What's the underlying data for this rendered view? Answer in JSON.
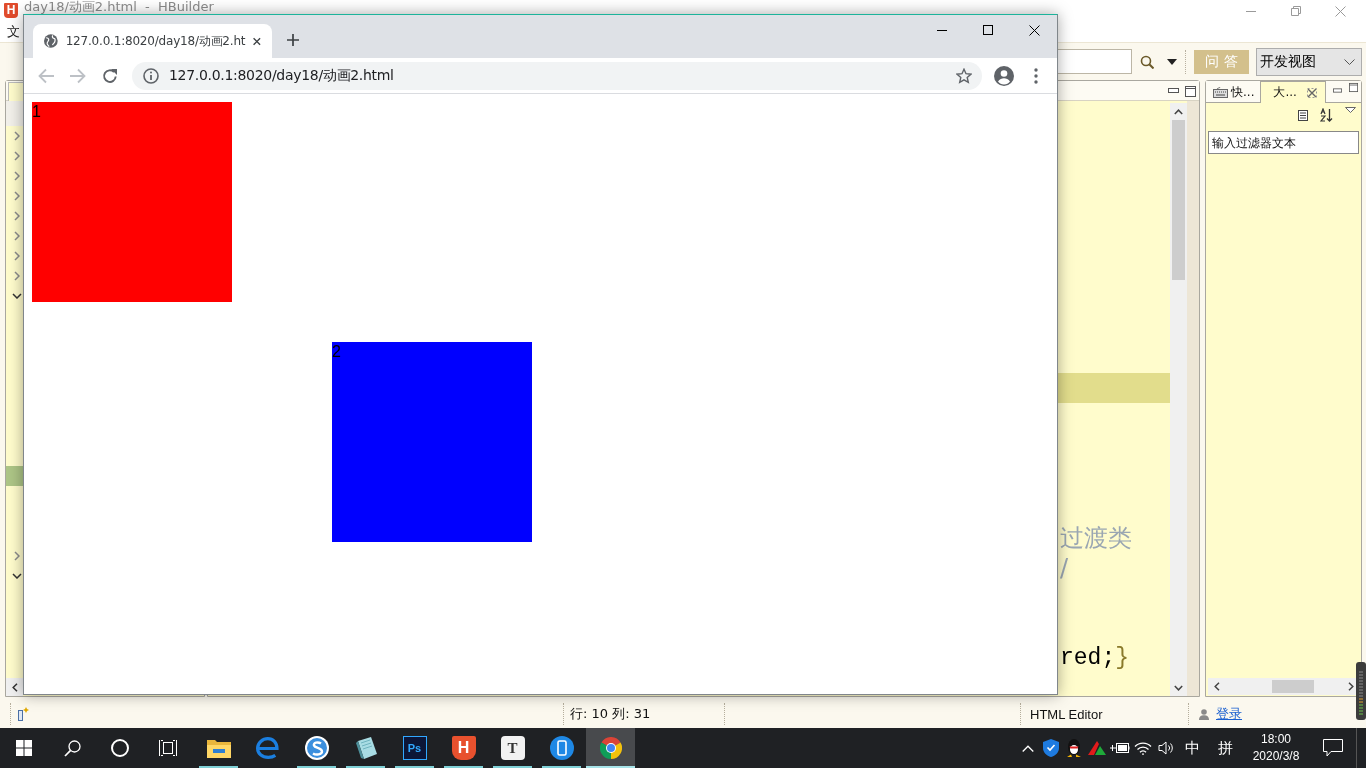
{
  "hbuilder": {
    "logo": "H",
    "title": "day18/动画2.html  -  HBuilder",
    "menu": [
      "文"
    ],
    "toolbar": {
      "qa_button": "问 答",
      "view_select": "开发视图"
    },
    "project_tree": [
      {
        "kind": "branch",
        "expanded": false,
        "selected": false
      },
      {
        "kind": "branch",
        "expanded": false,
        "selected": false
      },
      {
        "kind": "branch",
        "expanded": false,
        "selected": false
      },
      {
        "kind": "branch",
        "expanded": false,
        "selected": false
      },
      {
        "kind": "branch",
        "expanded": false,
        "selected": false
      },
      {
        "kind": "branch",
        "expanded": false,
        "selected": false
      },
      {
        "kind": "branch",
        "expanded": false,
        "selected": false
      },
      {
        "kind": "branch",
        "expanded": false,
        "selected": false
      },
      {
        "kind": "branch",
        "expanded": true,
        "selected": false
      },
      {
        "kind": "leaf",
        "selected": false
      },
      {
        "kind": "leaf",
        "selected": false
      },
      {
        "kind": "leaf",
        "selected": false
      },
      {
        "kind": "leaf",
        "selected": false
      },
      {
        "kind": "leaf",
        "selected": false
      },
      {
        "kind": "leaf",
        "selected": false
      },
      {
        "kind": "leaf",
        "selected": false
      },
      {
        "kind": "leaf",
        "selected": false
      },
      {
        "kind": "leaf",
        "selected": true
      },
      {
        "kind": "leaf",
        "selected": false
      },
      {
        "kind": "leaf",
        "selected": false
      },
      {
        "kind": "leaf",
        "selected": false
      },
      {
        "kind": "branch",
        "expanded": false,
        "selected": false
      },
      {
        "kind": "branch",
        "expanded": true,
        "selected": false
      }
    ],
    "editor": {
      "lines": [
        {
          "kind": "blank",
          "current": false
        },
        {
          "kind": "blank",
          "current": false
        },
        {
          "kind": "blank",
          "current": false
        },
        {
          "kind": "blank",
          "current": false
        },
        {
          "kind": "blank",
          "current": false
        },
        {
          "kind": "blank",
          "current": false
        },
        {
          "kind": "blank",
          "current": false
        },
        {
          "kind": "blank",
          "current": false
        },
        {
          "kind": "blank",
          "current": false
        },
        {
          "kind": "blank",
          "current": true
        },
        {
          "kind": "blank",
          "current": false
        },
        {
          "kind": "blank",
          "current": false
        },
        {
          "kind": "blank",
          "current": false
        },
        {
          "kind": "blank",
          "current": false
        },
        {
          "kind": "comment",
          "text": "过渡类",
          "current": false
        },
        {
          "kind": "comment",
          "text": "/",
          "current": false
        },
        {
          "kind": "blank",
          "current": false
        },
        {
          "kind": "blank",
          "current": false
        },
        {
          "kind": "code",
          "text": "red;",
          "close": "}",
          "current": false
        }
      ]
    },
    "outline_panel": {
      "tabs": [
        {
          "kind": "keyboard",
          "label": "快...",
          "selected": false
        },
        {
          "kind": "plain",
          "label": "大...",
          "selected": true
        }
      ],
      "filter": {
        "placeholder": "输入过滤器文本"
      }
    },
    "status_bar": {
      "position": "行: 10 列: 31",
      "editor_type": "HTML Editor",
      "login": "登录"
    }
  },
  "browser": {
    "tab": {
      "title": "127.0.0.1:8020/day18/动画2.ht"
    },
    "nav": {
      "back": {
        "disabled": true
      },
      "forward": {
        "disabled": true
      }
    },
    "address": "127.0.0.1:8020/day18/动画2.html",
    "page": {
      "squares": [
        {
          "label": "1",
          "color": "#ff0000"
        },
        {
          "label": "2",
          "color": "#0000ff"
        }
      ]
    }
  },
  "taskbar": {
    "apps": [
      {
        "kind": "folder",
        "running": true,
        "selected": false
      },
      {
        "kind": "e",
        "running": false,
        "selected": false
      },
      {
        "kind": "s",
        "running": true,
        "selected": false
      },
      {
        "kind": "notepad",
        "running": true,
        "selected": false
      },
      {
        "kind": "ps",
        "glyph": "Ps",
        "running": true,
        "selected": false
      },
      {
        "kind": "h",
        "glyph": "H",
        "running": true,
        "selected": false
      },
      {
        "kind": "t",
        "glyph": "T",
        "running": true,
        "selected": false
      },
      {
        "kind": "phone",
        "running": true,
        "selected": false
      },
      {
        "kind": "wheel",
        "running": true,
        "selected": true
      }
    ],
    "tray": {
      "icons": [
        {
          "kind": "chevron"
        },
        {
          "kind": "shield"
        },
        {
          "kind": "penguin"
        },
        {
          "kind": "peak"
        },
        {
          "kind": "battery"
        },
        {
          "kind": "wifi"
        },
        {
          "kind": "speaker"
        }
      ],
      "ime_mode": "中",
      "ime": "拼",
      "time": "18:00",
      "date": "2020/3/8"
    }
  }
}
